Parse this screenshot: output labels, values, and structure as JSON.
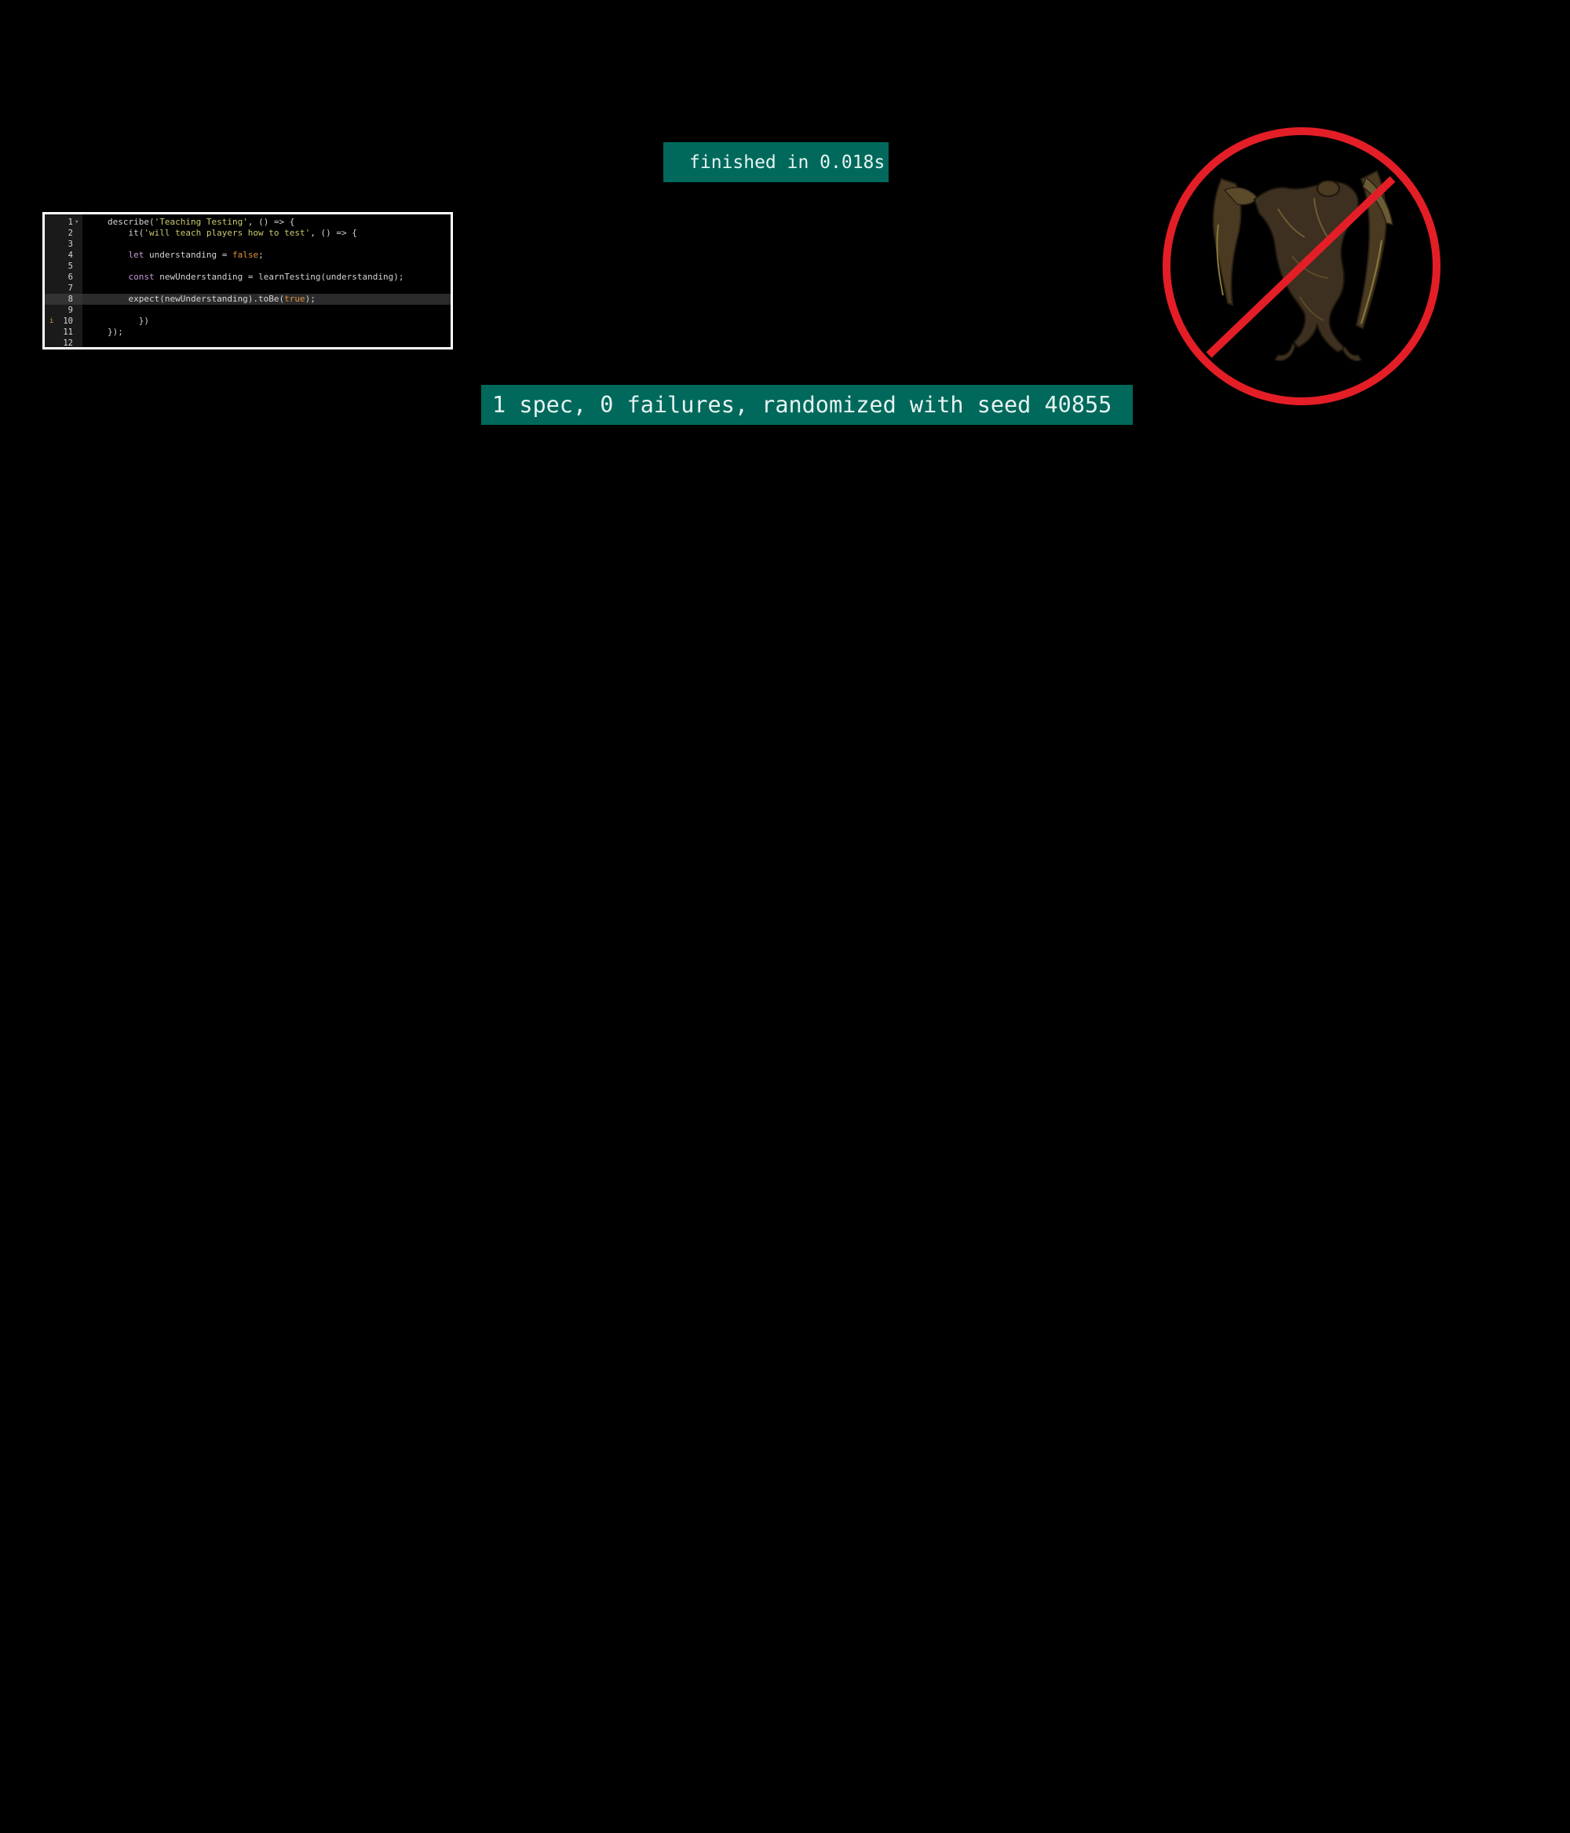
{
  "status": {
    "finished_label": "finished in 0.018s",
    "summary_label": "1 spec, 0 failures, randomized with seed 40855"
  },
  "editor": {
    "lines": [
      {
        "num": "1",
        "fold": "▾",
        "mark": "",
        "active": false,
        "tokens": [
          {
            "t": "describe(",
            "c": "plain"
          },
          {
            "t": "'Teaching Testing'",
            "c": "string"
          },
          {
            "t": ", () => {",
            "c": "plain"
          }
        ]
      },
      {
        "num": "2",
        "fold": "",
        "mark": "",
        "active": false,
        "tokens": [
          {
            "t": "    it(",
            "c": "plain"
          },
          {
            "t": "'will teach players how to test'",
            "c": "string"
          },
          {
            "t": ", () => {",
            "c": "plain"
          }
        ]
      },
      {
        "num": "3",
        "fold": "",
        "mark": "",
        "active": false,
        "tokens": []
      },
      {
        "num": "4",
        "fold": "",
        "mark": "",
        "active": false,
        "tokens": [
          {
            "t": "    ",
            "c": "plain"
          },
          {
            "t": "let",
            "c": "keyword"
          },
          {
            "t": " understanding = ",
            "c": "plain"
          },
          {
            "t": "false",
            "c": "bool"
          },
          {
            "t": ";",
            "c": "plain"
          }
        ]
      },
      {
        "num": "5",
        "fold": "",
        "mark": "",
        "active": false,
        "tokens": []
      },
      {
        "num": "6",
        "fold": "",
        "mark": "",
        "active": false,
        "tokens": [
          {
            "t": "    ",
            "c": "plain"
          },
          {
            "t": "const",
            "c": "keyword"
          },
          {
            "t": " newUnderstanding = learnTesting(understanding);",
            "c": "plain"
          }
        ]
      },
      {
        "num": "7",
        "fold": "",
        "mark": "",
        "active": false,
        "tokens": []
      },
      {
        "num": "8",
        "fold": "",
        "mark": "",
        "active": true,
        "tokens": [
          {
            "t": "    expect(newUnderstanding).toBe(",
            "c": "plain"
          },
          {
            "t": "true",
            "c": "bool"
          },
          {
            "t": ");",
            "c": "plain"
          }
        ]
      },
      {
        "num": "9",
        "fold": "",
        "mark": "",
        "active": false,
        "tokens": []
      },
      {
        "num": "10",
        "fold": "",
        "mark": "i",
        "active": false,
        "tokens": [
          {
            "t": "      })",
            "c": "plain"
          }
        ]
      },
      {
        "num": "11",
        "fold": "",
        "mark": "",
        "active": false,
        "tokens": [
          {
            "t": "});",
            "c": "plain"
          }
        ]
      },
      {
        "num": "12",
        "fold": "",
        "mark": "",
        "active": false,
        "tokens": []
      }
    ]
  },
  "colors": {
    "banner_bg": "#00695c",
    "prohibition_red": "#e41e26"
  },
  "icons": {
    "prohibition": "no-symbol-icon",
    "creature": "winged-creature-icon"
  }
}
